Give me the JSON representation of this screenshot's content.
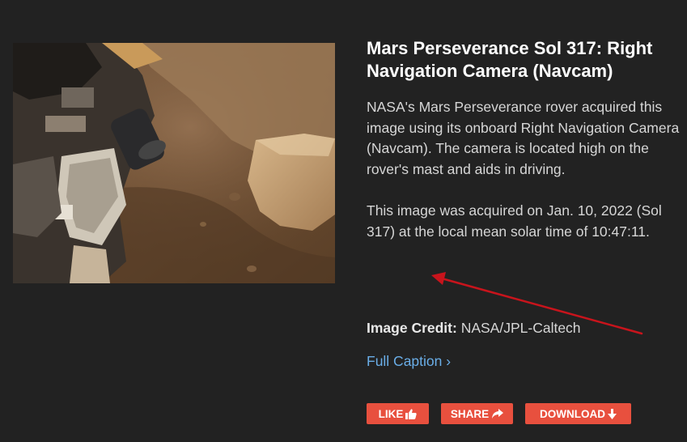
{
  "photo": {
    "alt": "Mars Perseverance Sol 317: Right Navigation Camera (Navcam)"
  },
  "caption": {
    "title": "Mars Perseverance Sol 317: Right Navigation Camera (Navcam)",
    "paragraph_1": "NASA's Mars Perseverance rover acquired this image using its onboard Right Navigation Camera (Navcam). The camera is located high on the rover's mast and aids in driving.",
    "paragraph_2": "This image was acquired on Jan. 10, 2022 (Sol 317) at the local mean solar time of 10:47:11.",
    "credit_label": "Image Credit:",
    "credit_value": "NASA/JPL-Caltech",
    "full_caption_link": "Full Caption ›"
  },
  "actions": {
    "like_label": "LIKE",
    "like_icon": "thumbs-up-icon",
    "share_label": "SHARE",
    "share_icon": "share-arrow-icon",
    "download_label": "DOWNLOAD",
    "download_icon": "arrow-down-icon"
  },
  "colors": {
    "background": "#222222",
    "title": "#ffffff",
    "body_text": "#d6d6d6",
    "link": "#6aaee8",
    "button": "#e8503e",
    "annotation_arrow": "#c8141c"
  }
}
